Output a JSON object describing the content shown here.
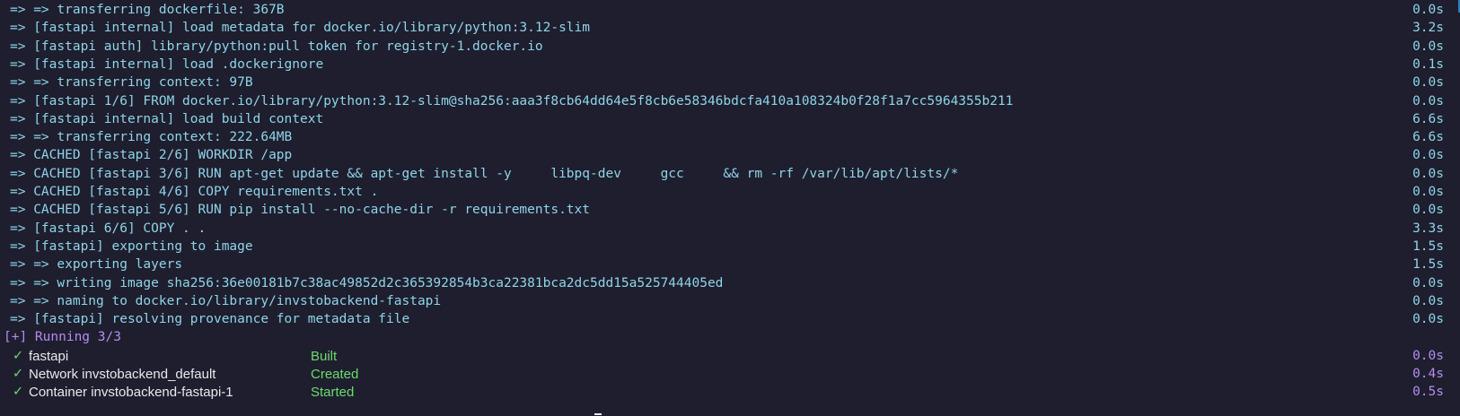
{
  "build_lines": [
    {
      "text": "=> => transferring dockerfile: 367B",
      "time": "0.0s"
    },
    {
      "text": "=> [fastapi internal] load metadata for docker.io/library/python:3.12-slim",
      "time": "3.2s"
    },
    {
      "text": "=> [fastapi auth] library/python:pull token for registry-1.docker.io",
      "time": "0.0s"
    },
    {
      "text": "=> [fastapi internal] load .dockerignore",
      "time": "0.1s"
    },
    {
      "text": "=> => transferring context: 97B",
      "time": "0.0s"
    },
    {
      "text": "=> [fastapi 1/6] FROM docker.io/library/python:3.12-slim@sha256:aaa3f8cb64dd64e5f8cb6e58346bdcfa410a108324b0f28f1a7cc5964355b211",
      "time": "0.0s"
    },
    {
      "text": "=> [fastapi internal] load build context",
      "time": "6.6s"
    },
    {
      "text": "=> => transferring context: 222.64MB",
      "time": "6.6s"
    },
    {
      "text": "=> CACHED [fastapi 2/6] WORKDIR /app",
      "time": "0.0s"
    },
    {
      "text": "=> CACHED [fastapi 3/6] RUN apt-get update && apt-get install -y     libpq-dev     gcc     && rm -rf /var/lib/apt/lists/*",
      "time": "0.0s"
    },
    {
      "text": "=> CACHED [fastapi 4/6] COPY requirements.txt .",
      "time": "0.0s"
    },
    {
      "text": "=> CACHED [fastapi 5/6] RUN pip install --no-cache-dir -r requirements.txt",
      "time": "0.0s"
    },
    {
      "text": "=> [fastapi 6/6] COPY . .",
      "time": "3.3s"
    },
    {
      "text": "=> [fastapi] exporting to image",
      "time": "1.5s"
    },
    {
      "text": "=> => exporting layers",
      "time": "1.5s"
    },
    {
      "text": "=> => writing image sha256:36e00181b7c38ac49852d2c365392854b3ca22381bca2dc5dd15a525744405ed",
      "time": "0.0s"
    },
    {
      "text": "=> => naming to docker.io/library/invstobackend-fastapi",
      "time": "0.0s"
    },
    {
      "text": "=> [fastapi] resolving provenance for metadata file",
      "time": "0.0s"
    }
  ],
  "running_header": "[+] Running 3/3",
  "services": [
    {
      "check": "✓",
      "name": "fastapi",
      "status": "Built",
      "time": "0.0s"
    },
    {
      "check": "✓",
      "name": "Network invstobackend_default",
      "status": "Created",
      "time": "0.4s"
    },
    {
      "check": "✓",
      "name": "Container invstobackend-fastapi-1",
      "status": "Started",
      "time": "0.5s"
    }
  ],
  "colors": {
    "background": "#1e1e2e",
    "build_text": "#8fd4e8",
    "running_header": "#b58cf0",
    "status_green": "#6bdc6b",
    "service_time": "#b58cf0"
  }
}
